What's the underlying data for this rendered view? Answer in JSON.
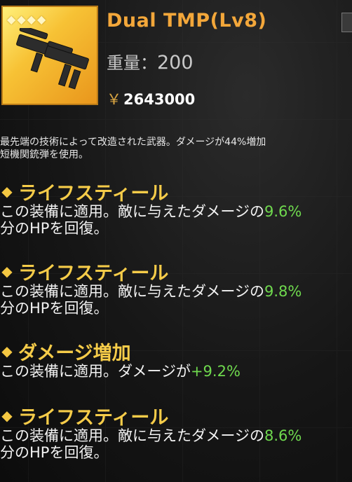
{
  "item": {
    "stars": [
      "◆",
      "◆",
      "◆",
      "◆"
    ],
    "title": "Dual TMP(Lv8)",
    "weight_label": "重量：",
    "weight_value": "200",
    "currency": "￥",
    "price": "2643000",
    "description_line1": "最先端の技術によって改造された武器。ダメージが44%増加",
    "description_line2": "短機関銃弾を使用。"
  },
  "colors": {
    "title": "#f3a73a",
    "section": "#f6cc49",
    "value": "#6fd94e"
  },
  "sections": [
    {
      "name": "ライフスティール",
      "pre": "この装備に適用。敵に与えたダメージの",
      "value": "9.6%",
      "line2": "分のHPを回復。"
    },
    {
      "name": "ライフスティール",
      "pre": "この装備に適用。敵に与えたダメージの",
      "value": "9.8%",
      "line2": "分のHPを回復。"
    },
    {
      "name": "ダメージ増加",
      "pre": "この装備に適用。ダメージが",
      "value": "+9.2%",
      "line2": ""
    },
    {
      "name": "ライフスティール",
      "pre": "この装備に適用。敵に与えたダメージの",
      "value": "8.6%",
      "line2": "分のHPを回復。"
    }
  ]
}
